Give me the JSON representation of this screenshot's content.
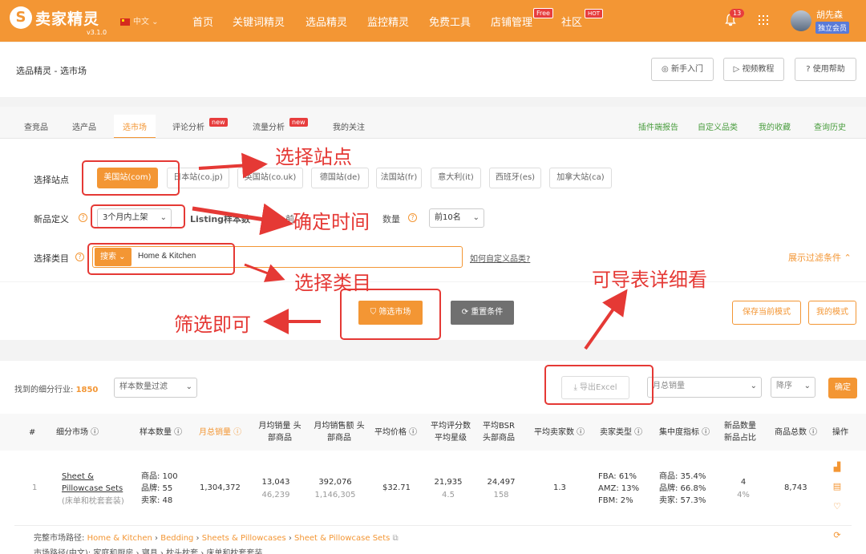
{
  "header": {
    "logo_text": "卖家精灵",
    "version": "v3.1.0",
    "language": "中文",
    "nav": [
      "首页",
      "关键词精灵",
      "选品精灵",
      "监控精灵",
      "免费工具",
      "店铺管理",
      "社区"
    ],
    "free_badge": "Free",
    "hot_badge": "HOT",
    "notification_count": "13",
    "user_name": "胡先森",
    "member_tag": "独立会员",
    "brand_color": "#f39634"
  },
  "breadcrumb": {
    "text": "选品精灵 - 选市场",
    "help_buttons": [
      "新手入门",
      "视频教程",
      "使用帮助"
    ]
  },
  "tabs": {
    "items": [
      "查竞品",
      "选产品",
      "选市场",
      "评论分析",
      "流量分析",
      "我的关注"
    ],
    "new_badge": "new",
    "right_links": [
      "插件端报告",
      "自定义品类",
      "我的收藏",
      "查询历史"
    ]
  },
  "filters": {
    "site_label": "选择站点",
    "sites": [
      "美国站(com)",
      "日本站(co.jp)",
      "英国站(co.uk)",
      "德国站(de)",
      "法国站(fr)",
      "意大利(it)",
      "西班牙(es)",
      "加拿大站(ca)"
    ],
    "new_label": "新品定义",
    "new_value": "3个月内上架",
    "listing_label": "Listing样本数",
    "listing_partial": "前",
    "count_label": "数量",
    "top_value": "前10名",
    "category_label": "选择类目",
    "category_mode": "搜索",
    "category_value": "Home & Kitchen",
    "how_to": "如何自定义品类?",
    "show_filters": "展示过滤条件"
  },
  "actions": {
    "filter": "筛选市场",
    "reset": "重置条件",
    "save_mode": "保存当前模式",
    "my_mode": "我的模式"
  },
  "results": {
    "found_label": "找到的细分行业:",
    "found_count": "1850",
    "sample_filter": "样本数量过滤",
    "export": "导出Excel",
    "sort_field": "月总销量",
    "sort_order": "降序",
    "confirm": "确定",
    "columns": [
      "#",
      "细分市场",
      "样本数量",
      "月总销量",
      "月均销量 头部商品",
      "月均销售额 头部商品",
      "平均价格",
      "平均评分数 平均星级",
      "平均BSR 头部商品",
      "平均卖家数",
      "卖家类型",
      "集中度指标",
      "新品数量 新品占比",
      "商品总数",
      "操作"
    ],
    "row": {
      "index": "1",
      "name_en": "Sheet & Pillowcase Sets",
      "name_cn": "(床单和枕套套装)",
      "sample": [
        "商品: 100",
        "品牌: 55",
        "卖家: 48"
      ],
      "monthly_sales": "1,304,372",
      "avg_sales": "13,043",
      "avg_sales_head": "46,239",
      "avg_revenue": "392,076",
      "avg_revenue_head": "1,146,305",
      "avg_price": "$32.71",
      "avg_reviews": "21,935",
      "avg_rating": "4.5",
      "avg_bsr": "24,497",
      "avg_bsr_head": "158",
      "avg_sellers": "1.3",
      "seller_types": [
        "FBA: 61%",
        "AMZ: 13%",
        "FBM: 2%"
      ],
      "concentration": [
        "商品: 35.4%",
        "品牌: 66.8%",
        "卖家: 57.3%"
      ],
      "new_count": "4",
      "new_ratio": "4%",
      "total": "8,743"
    },
    "full_path_label": "完整市场路径:",
    "full_path": [
      "Home & Kitchen",
      "Bedding",
      "Sheets & Pillowcases",
      "Sheet & Pillowcase Sets"
    ],
    "cn_path": "市场路径(中文): 家庭和厨房 › 寝具 › 枕头枕套 › 床单和枕套套装"
  },
  "annotations": {
    "site": "选择站点",
    "time": "确定时间",
    "category": "选择类目",
    "filter": "筛选即可",
    "export": "可导表详细看",
    "color": "#e53935"
  }
}
